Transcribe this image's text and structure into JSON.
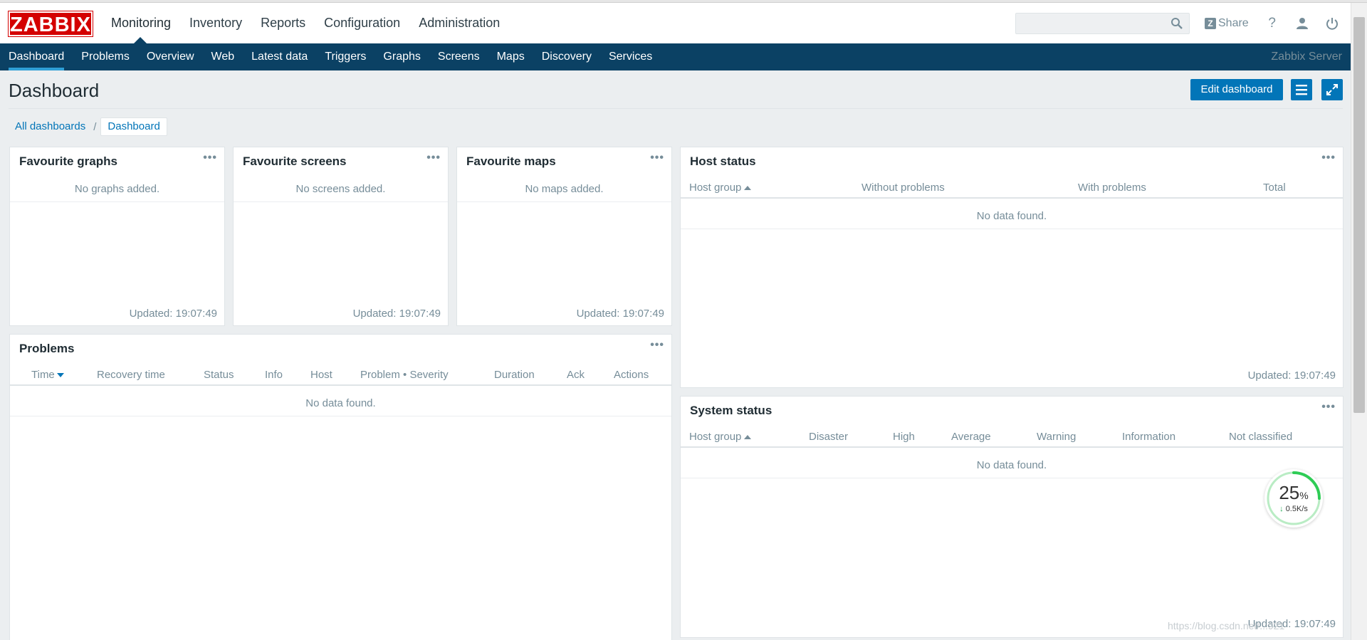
{
  "brand": {
    "logo": "ZABBIX",
    "color": "#d40000"
  },
  "main_menu": [
    "Monitoring",
    "Inventory",
    "Reports",
    "Configuration",
    "Administration"
  ],
  "search": {
    "placeholder": "",
    "icon": "search-icon"
  },
  "top_actions": {
    "share": "Share",
    "help": "?",
    "user_icon": "user-icon",
    "logout_icon": "power-icon"
  },
  "sub_menu": [
    "Dashboard",
    "Problems",
    "Overview",
    "Web",
    "Latest data",
    "Triggers",
    "Graphs",
    "Screens",
    "Maps",
    "Discovery",
    "Services"
  ],
  "server_name": "Zabbix Server",
  "colors": {
    "nav": "#0b4164",
    "accent": "#0275b8"
  },
  "page": {
    "title": "Dashboard",
    "edit_button": "Edit dashboard",
    "breadcrumb": {
      "parent": "All dashboards",
      "separator": "/",
      "current": "Dashboard"
    }
  },
  "widgets": {
    "fav_graphs": {
      "title": "Favourite graphs",
      "empty": "No graphs added.",
      "updated": "Updated: 19:07:49"
    },
    "fav_screens": {
      "title": "Favourite screens",
      "empty": "No screens added.",
      "updated": "Updated: 19:07:49"
    },
    "fav_maps": {
      "title": "Favourite maps",
      "empty": "No maps added.",
      "updated": "Updated: 19:07:49"
    },
    "host_status": {
      "title": "Host status",
      "columns": [
        "Host group",
        "Without problems",
        "With problems",
        "Total"
      ],
      "empty": "No data found.",
      "updated": "Updated: 19:07:49"
    },
    "problems": {
      "title": "Problems",
      "columns": [
        "Time",
        "Recovery time",
        "Status",
        "Info",
        "Host",
        "Problem • Severity",
        "Duration",
        "Ack",
        "Actions"
      ],
      "empty": "No data found."
    },
    "system_status": {
      "title": "System status",
      "columns": [
        "Host group",
        "Disaster",
        "High",
        "Average",
        "Warning",
        "Information",
        "Not classified"
      ],
      "empty": "No data found.",
      "updated": "Updated: 19:07:49"
    }
  },
  "gauge": {
    "percent": "25",
    "unit": "%",
    "speed": "0.5K/s",
    "fraction": 0.25
  },
  "watermark": "https://blog.csdn.net/...921"
}
